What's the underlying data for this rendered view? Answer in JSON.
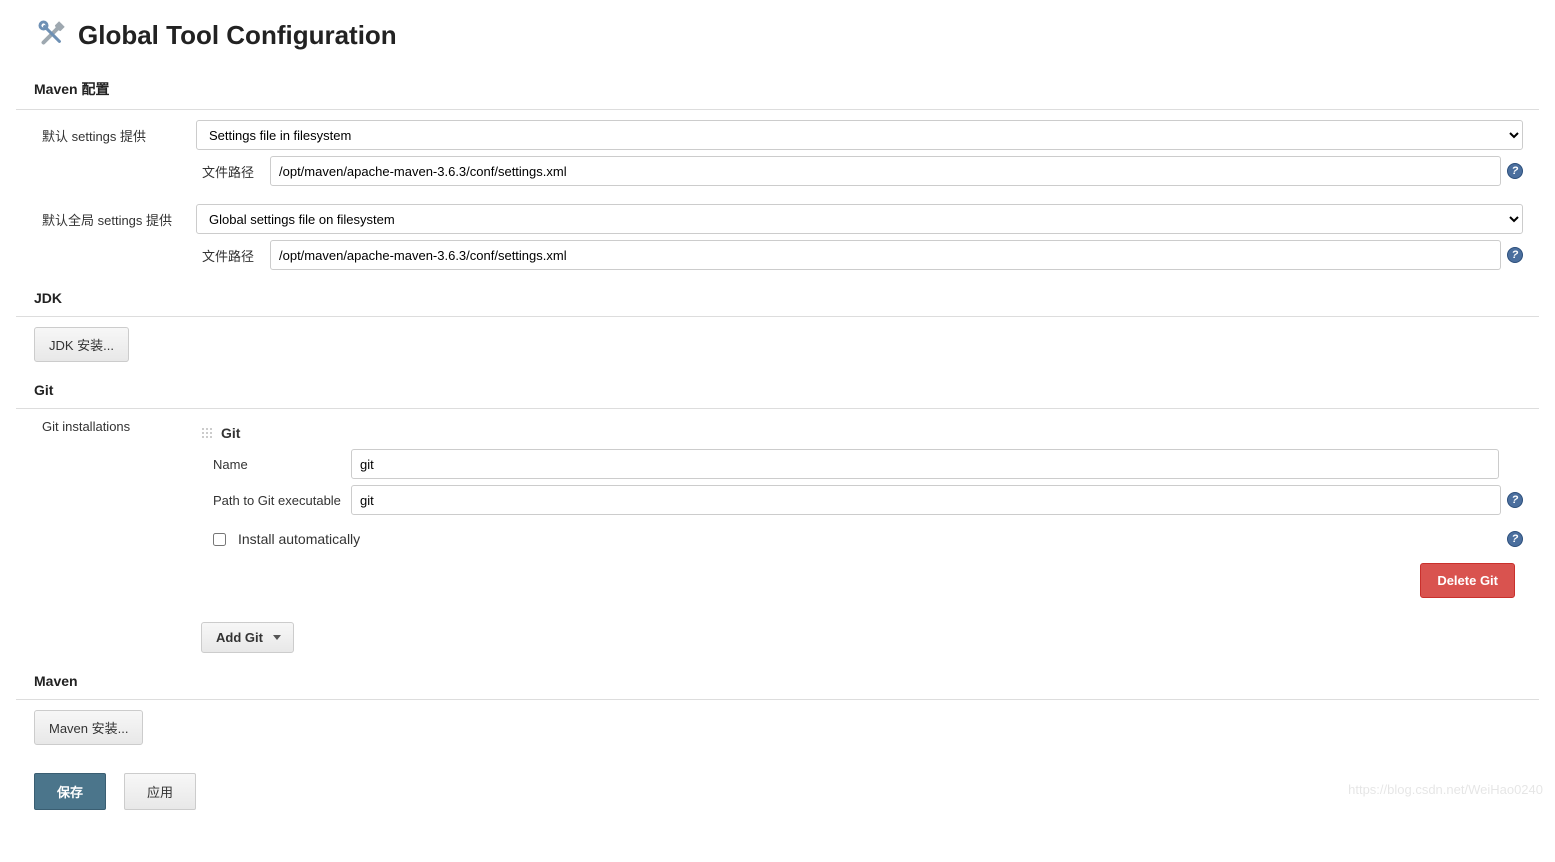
{
  "header": {
    "title": "Global Tool Configuration"
  },
  "maven_config": {
    "section_title": "Maven 配置",
    "default_settings_label": "默认 settings 提供",
    "default_settings_value": "Settings file in filesystem",
    "file_path_label": "文件路径",
    "file_path_value": "/opt/maven/apache-maven-3.6.3/conf/settings.xml",
    "default_global_settings_label": "默认全局 settings 提供",
    "default_global_settings_value": "Global settings file on filesystem",
    "global_file_path_label": "文件路径",
    "global_file_path_value": "/opt/maven/apache-maven-3.6.3/conf/settings.xml"
  },
  "jdk": {
    "section_title": "JDK",
    "install_button": "JDK 安装..."
  },
  "git": {
    "section_title": "Git",
    "installations_label": "Git installations",
    "block_title": "Git",
    "name_label": "Name",
    "name_value": "git",
    "path_label": "Path to Git executable",
    "path_value": "git",
    "install_auto_label": "Install automatically",
    "delete_button": "Delete Git",
    "add_button": "Add Git"
  },
  "maven": {
    "section_title": "Maven",
    "install_button": "Maven 安装..."
  },
  "buttons": {
    "save": "保存",
    "apply": "应用"
  },
  "watermark": "https://blog.csdn.net/WeiHao0240"
}
